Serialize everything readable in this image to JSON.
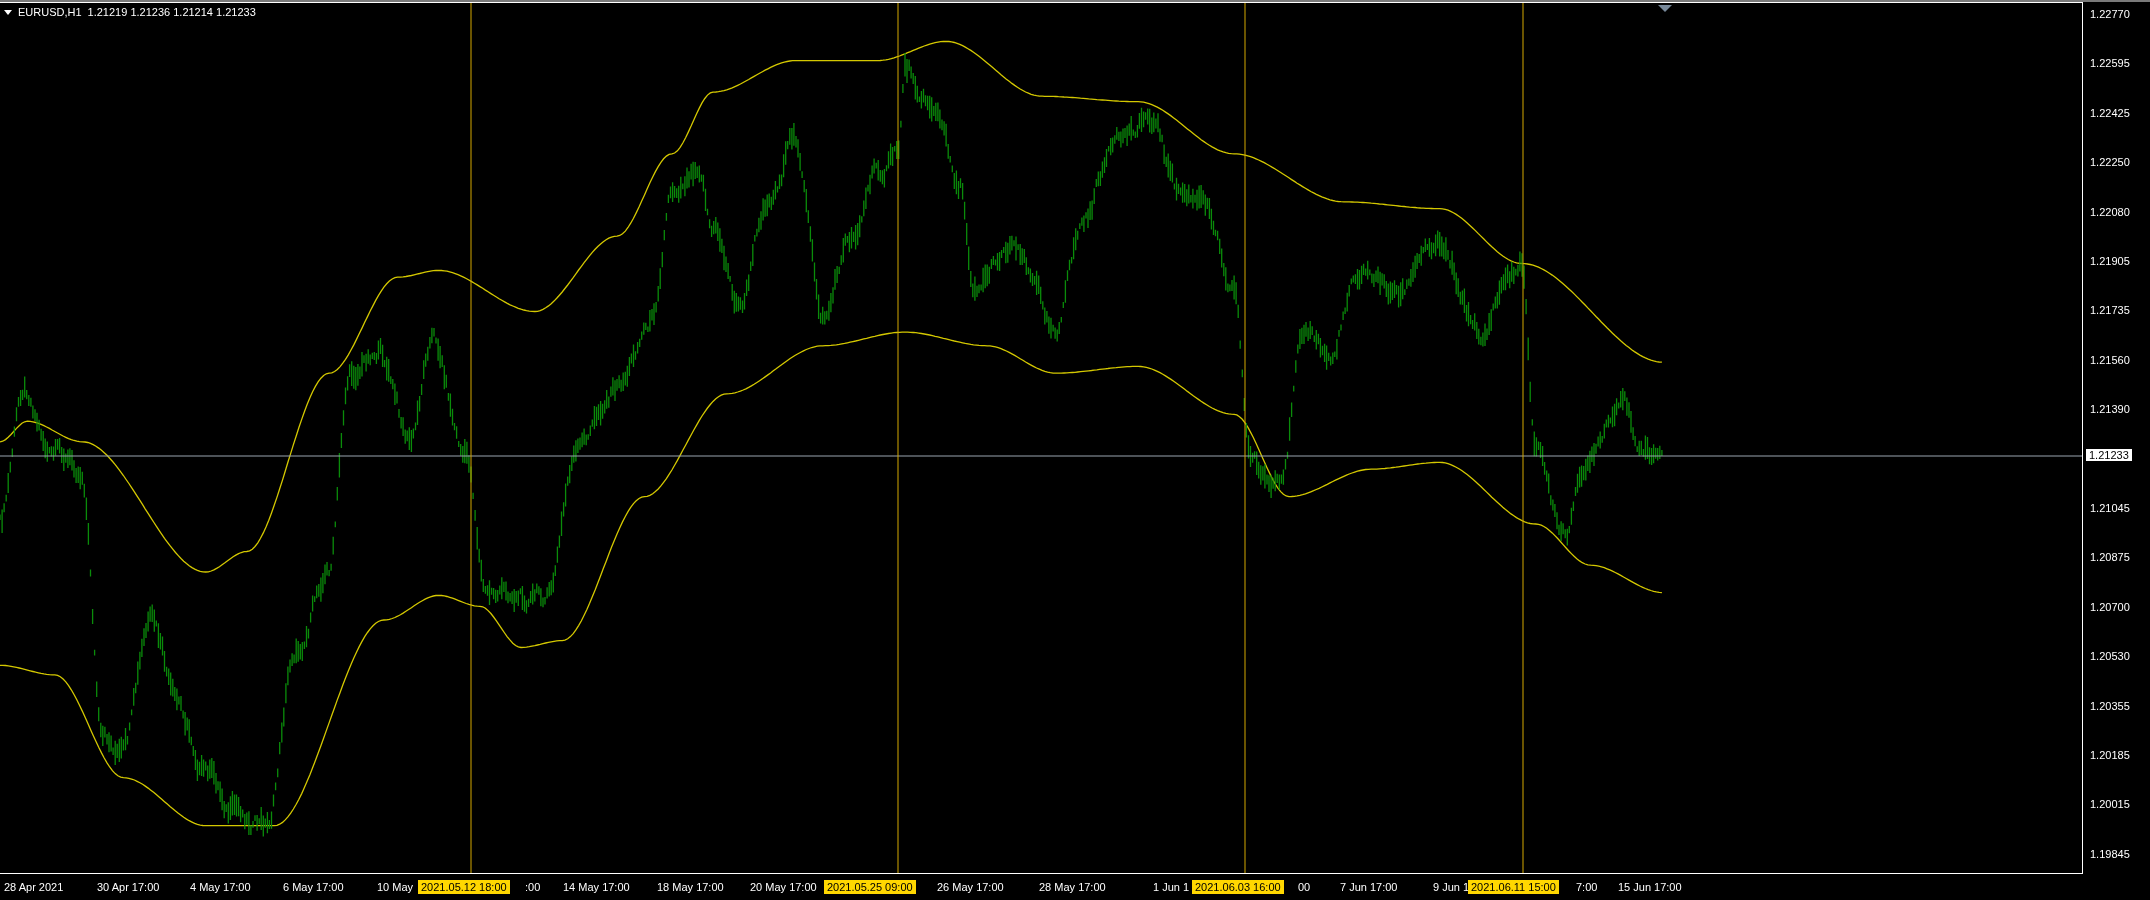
{
  "header": {
    "symbol": "EURUSD,H1",
    "quotes": "1.21219 1.21236 1.21214 1.21233"
  },
  "price_axis": [
    "1.22770",
    "1.22595",
    "1.22425",
    "1.22250",
    "1.22080",
    "1.21905",
    "1.21735",
    "1.21560",
    "1.21390",
    "1.21045",
    "1.20875",
    "1.20700",
    "1.20530",
    "1.20355",
    "1.20185",
    "1.20015",
    "1.19845"
  ],
  "current_price": "1.21233",
  "time_axis": [
    "28 Apr 2021",
    "30 Apr 17:00",
    "4 May 17:00",
    "6 May 17:00",
    "10 May",
    ":00",
    "14 May 17:00",
    "18 May 17:00",
    "20 May 17:00",
    "26 May 17:00",
    "28 May 17:00",
    "1 Jun 1",
    "00",
    "7 Jun 17:00",
    "9 Jun 1",
    "7:00",
    "15 Jun 17:00"
  ],
  "time_markers": [
    "2021.05.12 18:00",
    "2021.05.25 09:00",
    "2021.06.03 16:00",
    "2021.06.11 15:00"
  ]
}
